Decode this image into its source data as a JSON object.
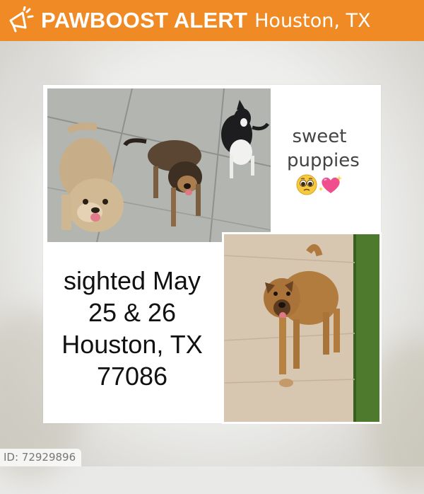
{
  "header": {
    "brand": "PAWBOOST ALERT",
    "location": "Houston, TX",
    "bar_color": "#f08a24",
    "icon": "megaphone-icon"
  },
  "poster": {
    "caption_lines": [
      "sweet",
      "puppies"
    ],
    "caption_emojis": [
      "pleading-face-emoji",
      "sparkling-heart-emoji"
    ],
    "sighted_lines": [
      "sighted May",
      "25 & 26",
      "Houston, TX",
      "77086"
    ],
    "photos": [
      "three-dogs-photo",
      "tan-dog-photo"
    ]
  },
  "footer": {
    "id_text": "ID: 72929896"
  }
}
